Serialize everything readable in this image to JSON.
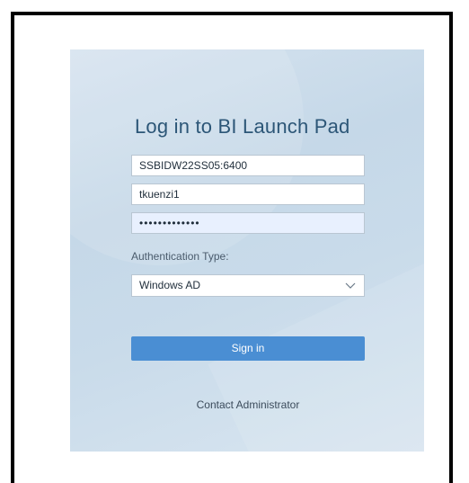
{
  "login": {
    "title": "Log in to BI Launch Pad",
    "server": "SSBIDW22SS05:6400",
    "username": "tkuenzi1",
    "password_masked": "•••••••••••••",
    "auth_label": "Authentication Type:",
    "auth_type": "Windows AD",
    "signin_label": "Sign in",
    "contact_label": "Contact Administrator"
  },
  "colors": {
    "title": "#2c5677",
    "button": "#4a8ed3",
    "panel": "#c9dbea",
    "password_bg": "#e8f0fe"
  },
  "icons": {
    "auth_select": "chevron-down-icon"
  }
}
